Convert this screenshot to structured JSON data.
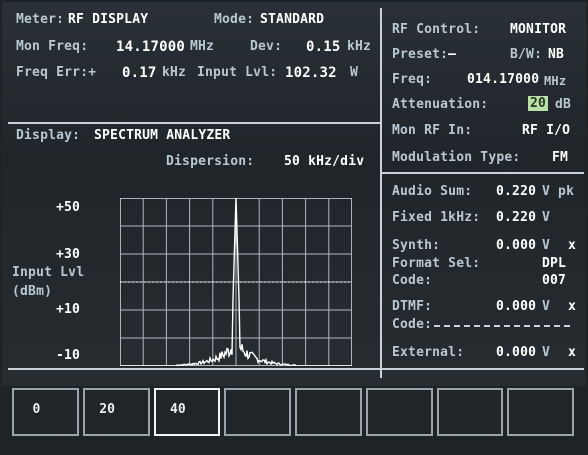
{
  "meter": {
    "label": "Meter:",
    "value": "RF DISPLAY"
  },
  "mode": {
    "label": "Mode:",
    "value": "STANDARD"
  },
  "mon_freq": {
    "label": "Mon Freq:",
    "value": "14.17000",
    "unit": "MHz"
  },
  "dev": {
    "label": "Dev:",
    "value": "0.15",
    "unit": "kHz"
  },
  "freq_err": {
    "label": "Freq Err:+",
    "value": "0.17",
    "unit": "kHz"
  },
  "input_lvl": {
    "label": "Input Lvl:",
    "value": "102.32",
    "unit": "W"
  },
  "rf_control": {
    "title_label": "RF Control:",
    "title_value": "MONITOR",
    "preset_label": "Preset:",
    "preset_value": "—",
    "bw_label": "B/W:",
    "bw_value": "NB",
    "freq_label": "Freq:",
    "freq_value": "014.17000",
    "freq_unit": "MHz",
    "attenuation_label": "Attenuation:",
    "attenuation_value": "20",
    "attenuation_unit": "dB",
    "mon_rf_in_label": "Mon RF In:",
    "mon_rf_in_value": "RF I/O",
    "modulation_label": "Modulation Type:",
    "modulation_value": "FM"
  },
  "display": {
    "label": "Display:",
    "value": "SPECTRUM ANALYZER"
  },
  "dispersion": {
    "label": "Dispersion:",
    "value": "50 kHz/div"
  },
  "y_axis": {
    "label_line1": "Input Lvl",
    "label_line2": "(dBm)",
    "ticks": [
      "+50",
      "+30",
      "+10",
      "-10"
    ]
  },
  "audio": {
    "audio_sum_label": "Audio Sum:",
    "audio_sum_value": "0.220",
    "audio_sum_unit": "V pk",
    "fixed_label": "Fixed 1kHz:",
    "fixed_value": "0.220",
    "fixed_unit": "V",
    "synth_label": "Synth:",
    "synth_value": "0.000",
    "synth_unit": "V",
    "format_label": "Format Sel:",
    "format_value": "DPL",
    "code_label": "Code:",
    "code_value": "007",
    "dtmf_label": "DTMF:",
    "dtmf_value": "0.000",
    "dtmf_unit": "V",
    "dtmf_code_label": "Code:",
    "external_label": "External:",
    "external_value": "0.000",
    "external_unit": "V",
    "off_mark": "x"
  },
  "softkeys": [
    "0",
    "20",
    "40",
    "",
    "",
    "",
    "",
    ""
  ],
  "chart_data": {
    "type": "line",
    "title": "",
    "xlabel": "",
    "ylabel": "Input Lvl (dBm)",
    "yticks": [
      "+50",
      "+30",
      "+10",
      "-10"
    ],
    "ylim": [
      -10,
      50
    ],
    "x_divisions": 10,
    "y_divisions": 6,
    "dispersion": "50 kHz/div",
    "center_peak_level": 50,
    "noise_floor_level": -10
  }
}
